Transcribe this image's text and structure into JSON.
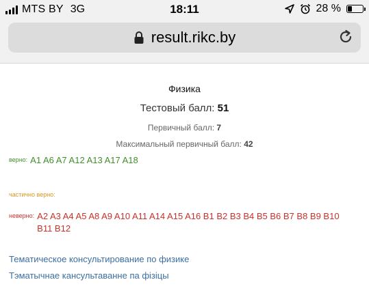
{
  "status_bar": {
    "carrier": "MTS BY",
    "network": "3G",
    "time": "18:11",
    "battery_percent": "28 %",
    "battery_level": 0.28,
    "icons": [
      "signal-icon",
      "location-arrow-icon",
      "alarm-clock-icon",
      "battery-icon"
    ]
  },
  "address_bar": {
    "url": "result.rikc.by",
    "icons": [
      "lock-icon",
      "reload-icon"
    ]
  },
  "result": {
    "subject": "Физика",
    "test_score_label": "Тестовый балл:",
    "test_score": "51",
    "primary_score_label": "Первичный балл:",
    "primary_score": "7",
    "max_primary_label": "Максимальный первичный балл:",
    "max_primary": "42",
    "correct_label": "верно:",
    "correct_items": "A1 A6 A7 A12 A13 A17 A18",
    "partial_label": "частично верно:",
    "wrong_label": "неверно:",
    "wrong_items": "A2 A3 A4 A5 A8 A9 A10 A11 A14 A15 A16 B1 B2 B3 B4 B5 B6 B7 B8 B9 B10 B11 B12"
  },
  "links": {
    "consult_ru": "Тематическое консультирование по физике",
    "consult_by": "Тэматычнае кансультаванне па фізіцы"
  },
  "colors": {
    "correct": "#3f8f2a",
    "partial": "#d8961c",
    "wrong": "#c9312a",
    "link": "#3b6ea5"
  }
}
